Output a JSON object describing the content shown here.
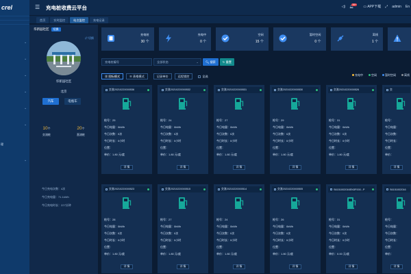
{
  "sidebar": {
    "logo": "crel",
    "nav_text": "理"
  },
  "topbar": {
    "title": "充电桩收费云平台",
    "badge": "99+",
    "app_download": "APP下载",
    "user": "admin",
    "lang": "En"
  },
  "tabs": [
    {
      "label": "首页"
    },
    {
      "label": "实时监控"
    },
    {
      "label": "站点监控"
    },
    {
      "label": "充电记录"
    }
  ],
  "left_panel": {
    "title": "华新园社区",
    "tag": "切换",
    "switch_label": "切换",
    "station_name": "华新园社区",
    "location": "北京",
    "type_buttons": [
      {
        "label": "汽车"
      },
      {
        "label": "电瓶车"
      }
    ],
    "stats": [
      {
        "value": "10",
        "unit": "个",
        "label": "交流桩"
      },
      {
        "value": "20",
        "unit": "个",
        "label": "直流桩"
      }
    ],
    "info": [
      "今日充电次数：4次",
      "今日充电量：71.1kWh",
      "今日充电时长：227分钟"
    ]
  },
  "summary": [
    {
      "label": "充电桩",
      "value": "30",
      "unit": "个",
      "icon": "plug-icon",
      "color": "#1f6fd1"
    },
    {
      "label": "充电中",
      "value": "0",
      "unit": "个",
      "icon": "lightning-icon",
      "color": "#1f6fd1"
    },
    {
      "label": "空闲",
      "value": "15",
      "unit": "个",
      "icon": "check-circle-icon",
      "color": "#1f6fd1"
    },
    {
      "label": "暂时空闲",
      "value": "0",
      "unit": "个",
      "icon": "check-circle-icon",
      "color": "#1f6fd1"
    },
    {
      "label": "离线",
      "value": "1",
      "unit": "个",
      "icon": "unplug-icon",
      "color": "#1f6fd1"
    },
    {
      "label": "故障",
      "value": "",
      "unit": "",
      "icon": "warning-icon",
      "color": "#1f6fd1"
    }
  ],
  "filters": {
    "pile_number_placeholder": "充电桩编号",
    "status_select": "全部状态",
    "search_button": "搜索",
    "reset_button": "重置"
  },
  "modes": {
    "icon_mode": "图标模式",
    "list_mode": "表格模式",
    "record_button": "记录单价",
    "ended_button": "远程锁控",
    "select_all": "全选"
  },
  "legend": [
    {
      "label": "充电中",
      "color": "#f5b93a"
    },
    {
      "label": "空闲",
      "color": "#2ec27e"
    },
    {
      "label": "暂时空闲",
      "color": "#3f8df0"
    },
    {
      "label": "离线",
      "color": "#8a8f98"
    }
  ],
  "card_labels": {
    "gun": "枪号：",
    "energy": "今日电量：",
    "count": "今日次数：",
    "duration": "今日时长：",
    "position": "位置：",
    "price": "单价：",
    "details": "详 情"
  },
  "cards": [
    {
      "title": "交流20210220000536",
      "gun": "25",
      "energy": "0kWh",
      "count": "0次",
      "duration": "0小时",
      "position": "",
      "price": "1.80 元/度",
      "status_color": "#2ec27e"
    },
    {
      "title": "交流20210220000532",
      "gun": "24",
      "energy": "0kWh",
      "count": "0次",
      "duration": "0小时",
      "position": "",
      "price": "1.80 元/度",
      "status_color": "#2ec27e"
    },
    {
      "title": "交流20210220000531",
      "gun": "27",
      "energy": "0kWh",
      "count": "0次",
      "duration": "0小时",
      "position": "",
      "price": "1.80 元/度",
      "status_color": "#2ec27e"
    },
    {
      "title": "交流20210220000530",
      "gun": "29",
      "energy": "0kWh",
      "count": "0次",
      "duration": "0小时",
      "position": "",
      "price": "1.80 元/度",
      "status_color": "#2ec27e"
    },
    {
      "title": "交流20210220000526",
      "gun": "31",
      "energy": "0kWh",
      "count": "0次",
      "duration": "0小时",
      "position": "",
      "price": "1.80 元/度",
      "status_color": "#2ec27e"
    },
    {
      "title": "交",
      "gun": "",
      "energy": "",
      "count": "",
      "duration": "",
      "position": "",
      "price": "",
      "status_color": "#2ec27e"
    },
    {
      "title": "交流20210220000523",
      "gun": "28",
      "energy": "0kWh",
      "count": "0次",
      "duration": "0小时",
      "position": "",
      "price": "1.80 元/度",
      "status_color": "#2ec27e"
    },
    {
      "title": "交流20210220000515",
      "gun": "27",
      "energy": "0kWh",
      "count": "0次",
      "duration": "0小时",
      "position": "",
      "price": "1.80 元/度",
      "status_color": "#2ec27e"
    },
    {
      "title": "交流20210220000514",
      "gun": "24",
      "energy": "0kWh",
      "count": "0次",
      "duration": "0小时",
      "position": "",
      "price": "1.80 元/度",
      "status_color": "#2ec27e"
    },
    {
      "title": "交流20210220000505",
      "gun": "26",
      "energy": "0kWh",
      "count": "0次",
      "duration": "0小时",
      "position": "",
      "price": "1.80 元/度",
      "status_color": "#2ec27e"
    },
    {
      "title": "S6151002016EN3F000...P",
      "gun": "31",
      "energy": "0kWh",
      "count": "0次",
      "duration": "0小时",
      "position": "",
      "price": "0.00 元/度",
      "status_color": "#2ec27e"
    },
    {
      "title": "S6151002016",
      "gun": "",
      "energy": "",
      "count": "",
      "duration": "",
      "position": "",
      "price": "",
      "status_color": "#2ec27e"
    }
  ]
}
